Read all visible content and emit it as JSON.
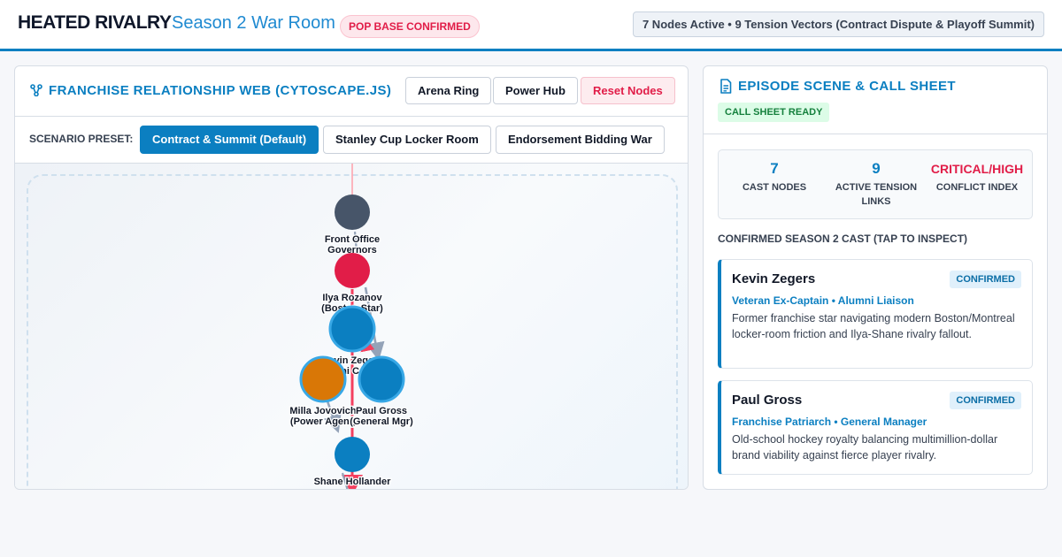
{
  "header": {
    "brand": "HEATED RIVALRY",
    "subtitle": "Season 2 War Room",
    "status_badge": "POP BASE CONFIRMED",
    "stats": "7 Nodes Active • 9 Tension Vectors (Contract Dispute & Playoff Summit)"
  },
  "graph_panel": {
    "title": "FRANCHISE RELATIONSHIP WEB (CYTOSCAPE.JS)",
    "icon": "network-icon",
    "layout_buttons": [
      "Arena Ring",
      "Power Hub"
    ],
    "reset_label": "Reset Nodes",
    "preset_label": "SCENARIO PRESET:",
    "presets": [
      {
        "label": "Contract & Summit (Default)",
        "active": true
      },
      {
        "label": "Stanley Cup Locker Room",
        "active": false
      },
      {
        "label": "Endorsement Bidding War",
        "active": false
      }
    ],
    "nodes": [
      {
        "id": "front",
        "lines": [
          "Front Office",
          "Governors"
        ],
        "color": "#475569",
        "ring": false,
        "large": false
      },
      {
        "id": "ilya",
        "lines": [
          "Ilya Rozanov",
          "(Boston Star)"
        ],
        "color": "#e11d48",
        "ring": false,
        "large": false
      },
      {
        "id": "kevin",
        "lines": [
          "Kevin Zegers",
          "(Alumni Captain)"
        ],
        "color": "#0b7fc1",
        "ring": true,
        "large": true
      },
      {
        "id": "milla",
        "lines": [
          "Milla Jovovich",
          "(Power Agent)"
        ],
        "color": "#d97706",
        "ring": true,
        "large": true
      },
      {
        "id": "paul",
        "lines": [
          "Paul Gross",
          "(General Mgr)"
        ],
        "color": "#0b7fc1",
        "ring": true,
        "large": true
      },
      {
        "id": "shane",
        "lines": [
          "Shane Hollander",
          ""
        ],
        "color": "#0b7fc1",
        "ring": false,
        "large": false
      }
    ],
    "colors": {
      "tension": "#f43f5e",
      "neutral": "#94a3b8",
      "accent": "#0b7fc1"
    }
  },
  "scene_panel": {
    "title": "EPISODE SCENE & CALL SHEET",
    "icon": "document-icon",
    "ready_badge": "CALL SHEET READY",
    "metrics": [
      {
        "value": "7",
        "label_lines": [
          "CAST NODES",
          ""
        ]
      },
      {
        "value": "9",
        "label_lines": [
          "ACTIVE TENSION",
          "LINKS"
        ]
      },
      {
        "value": "CRITICAL/HIGH",
        "label_lines": [
          "CONFLICT INDEX",
          ""
        ]
      }
    ],
    "cast_heading": "CONFIRMED SEASON 2 CAST (TAP TO INSPECT)",
    "cast": [
      {
        "name": "Kevin Zegers",
        "badge": "CONFIRMED",
        "role": "Veteran Ex-Captain • Alumni Liaison",
        "description": "Former franchise star navigating modern Boston/Montreal locker-room friction and Ilya-Shane rivalry fallout."
      },
      {
        "name": "Paul Gross",
        "badge": "CONFIRMED",
        "role": "Franchise Patriarch • General Manager",
        "description": "Old-school hockey royalty balancing multimillion-dollar brand viability against fierce player rivalry."
      }
    ]
  }
}
